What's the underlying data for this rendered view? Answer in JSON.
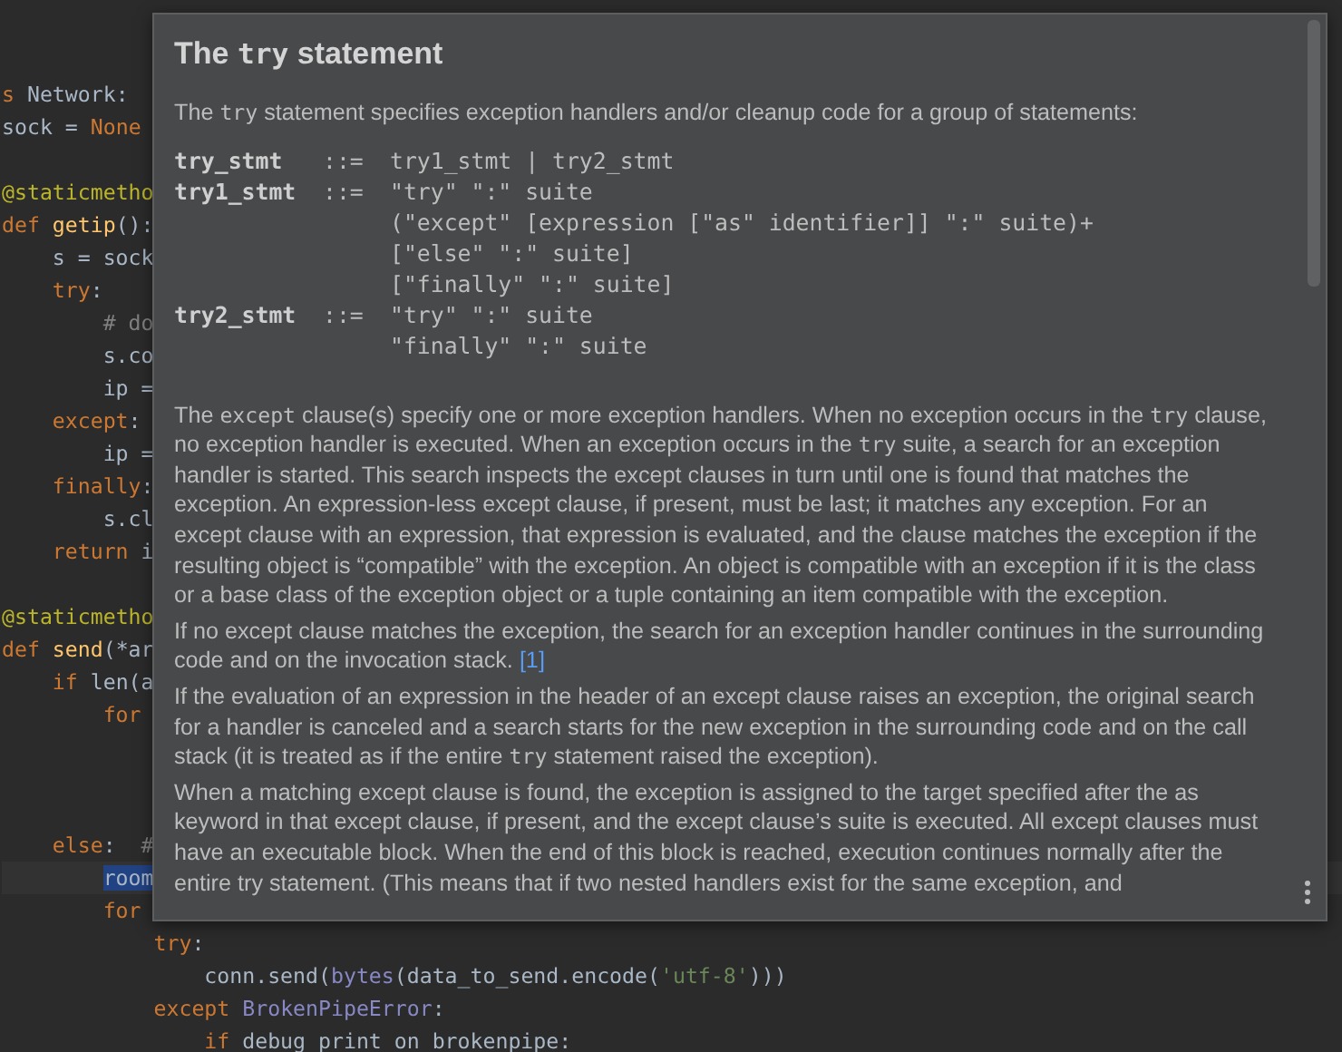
{
  "editor": {
    "lines": [
      {
        "kind": "blank"
      },
      {
        "kind": "blank"
      },
      {
        "kind": "code",
        "tokens": [
          {
            "kind": "keyword",
            "text": "s"
          },
          {
            "kind": "plain",
            "text": " Network:"
          }
        ]
      },
      {
        "kind": "code",
        "tokens": [
          {
            "kind": "plain",
            "text": "sock = "
          },
          {
            "kind": "keyword",
            "text": "None"
          }
        ]
      },
      {
        "kind": "blank"
      },
      {
        "kind": "code",
        "tokens": [
          {
            "kind": "decorator",
            "text": "@staticmetho"
          }
        ]
      },
      {
        "kind": "code",
        "tokens": [
          {
            "kind": "keyword",
            "text": "def "
          },
          {
            "kind": "function",
            "text": "getip"
          },
          {
            "kind": "plain",
            "text": "():"
          }
        ],
        "children": [
          {
            "kind": "code",
            "tokens": [
              {
                "kind": "plain",
                "text": "s = sock"
              }
            ]
          },
          {
            "kind": "code",
            "tokens": [
              {
                "kind": "keyword",
                "text": "try"
              },
              {
                "kind": "plain",
                "text": ":"
              }
            ],
            "children": [
              {
                "kind": "code",
                "tokens": [
                  {
                    "kind": "comment",
                    "text": "# do"
                  }
                ]
              },
              {
                "kind": "code",
                "tokens": [
                  {
                    "kind": "plain",
                    "text": "s.co"
                  }
                ]
              },
              {
                "kind": "code",
                "tokens": [
                  {
                    "kind": "plain",
                    "text": "ip ="
                  }
                ]
              }
            ]
          },
          {
            "kind": "code",
            "tokens": [
              {
                "kind": "keyword",
                "text": "except"
              },
              {
                "kind": "plain",
                "text": ":"
              }
            ],
            "children": [
              {
                "kind": "code",
                "tokens": [
                  {
                    "kind": "plain",
                    "text": "ip ="
                  }
                ]
              }
            ]
          },
          {
            "kind": "code",
            "tokens": [
              {
                "kind": "keyword",
                "text": "finally"
              },
              {
                "kind": "plain",
                "text": ":"
              }
            ],
            "children": [
              {
                "kind": "code",
                "tokens": [
                  {
                    "kind": "plain",
                    "text": "s.cl"
                  }
                ]
              }
            ]
          },
          {
            "kind": "code",
            "tokens": [
              {
                "kind": "keyword",
                "text": "return"
              },
              {
                "kind": "plain",
                "text": " i"
              }
            ]
          }
        ]
      },
      {
        "kind": "blank"
      },
      {
        "kind": "code",
        "tokens": [
          {
            "kind": "decorator",
            "text": "@staticmetho"
          }
        ]
      },
      {
        "kind": "code",
        "tokens": [
          {
            "kind": "keyword",
            "text": "def "
          },
          {
            "kind": "function",
            "text": "send"
          },
          {
            "kind": "plain",
            "text": "(*ar"
          }
        ],
        "children": [
          {
            "kind": "code",
            "tokens": [
              {
                "kind": "keyword",
                "text": "if"
              },
              {
                "kind": "plain",
                "text": " len(a"
              }
            ],
            "children": [
              {
                "kind": "code",
                "tokens": [
                  {
                    "kind": "keyword",
                    "text": "for"
                  }
                ]
              },
              {
                "kind": "blank"
              },
              {
                "kind": "blank"
              },
              {
                "kind": "blank"
              }
            ]
          },
          {
            "kind": "code",
            "tokens": [
              {
                "kind": "keyword",
                "text": "else"
              },
              {
                "kind": "plain",
                "text": ":  "
              },
              {
                "kind": "comment",
                "text": "#"
              }
            ],
            "children": [
              {
                "kind": "code",
                "tokens": [
                  {
                    "kind": "selection",
                    "text": "room"
                  }
                ]
              },
              {
                "kind": "code",
                "tokens": [
                  {
                    "kind": "keyword",
                    "text": "for"
                  }
                ],
                "children": [
                  {
                    "kind": "code",
                    "tokens": [
                      {
                        "kind": "keyword",
                        "text": "try"
                      },
                      {
                        "kind": "plain",
                        "text": ":"
                      }
                    ],
                    "children": [
                      {
                        "kind": "code",
                        "tokens": [
                          {
                            "kind": "plain",
                            "text": "conn.send("
                          },
                          {
                            "kind": "builtin",
                            "text": "bytes"
                          },
                          {
                            "kind": "plain",
                            "text": "(data_to_send.encode("
                          },
                          {
                            "kind": "string",
                            "text": "'utf-8'"
                          },
                          {
                            "kind": "plain",
                            "text": ")))"
                          }
                        ]
                      }
                    ]
                  },
                  {
                    "kind": "code",
                    "tokens": [
                      {
                        "kind": "keyword",
                        "text": "except "
                      },
                      {
                        "kind": "builtin",
                        "text": "BrokenPipeError"
                      },
                      {
                        "kind": "plain",
                        "text": ":"
                      }
                    ],
                    "children": [
                      {
                        "kind": "code",
                        "tokens": [
                          {
                            "kind": "keyword",
                            "text": "if"
                          },
                          {
                            "kind": "plain",
                            "text": " debug print on brokenpipe:"
                          }
                        ]
                      }
                    ]
                  }
                ]
              }
            ]
          }
        ]
      }
    ]
  },
  "doc_popup": {
    "title": [
      {
        "kind": "text",
        "text": "The "
      },
      {
        "kind": "code",
        "text": "try"
      },
      {
        "kind": "text",
        "text": " statement"
      }
    ],
    "intro": [
      {
        "kind": "text",
        "text": "The "
      },
      {
        "kind": "code",
        "text": "try"
      },
      {
        "kind": "text",
        "text": " statement specifies exception handlers and/or cleanup code for a group of statements:"
      }
    ],
    "grammar": [
      {
        "name": "try_stmt",
        "op": "::=",
        "lines": [
          "try1_stmt | try2_stmt"
        ]
      },
      {
        "name": "try1_stmt",
        "op": "::=",
        "lines": [
          "\"try\" \":\" suite",
          "(\"except\" [expression [\"as\" identifier]] \":\" suite)+",
          "[\"else\" \":\" suite]",
          "[\"finally\" \":\" suite]"
        ]
      },
      {
        "name": "try2_stmt",
        "op": "::=",
        "lines": [
          "\"try\" \":\" suite",
          "\"finally\" \":\" suite"
        ]
      }
    ],
    "paragraphs": [
      [
        {
          "kind": "text",
          "text": "The "
        },
        {
          "kind": "code",
          "text": "except"
        },
        {
          "kind": "text",
          "text": " clause(s) specify one or more exception handlers. When no exception occurs in the "
        },
        {
          "kind": "code",
          "text": "try"
        },
        {
          "kind": "text",
          "text": " clause, no exception handler is executed. When an exception occurs in the "
        },
        {
          "kind": "code",
          "text": "try"
        },
        {
          "kind": "text",
          "text": " suite, a search for an exception handler is started. This search inspects the except clauses in turn until one is found that matches the exception. An expression-less except clause, if present, must be last; it matches any exception. For an except clause with an expression, that expression is evaluated, and the clause matches the exception if the resulting object is “compatible” with the exception. An object is compatible with an exception if it is the class or a base class of the exception object or a tuple containing an item compatible with the exception."
        }
      ],
      [
        {
          "kind": "text",
          "text": "If no except clause matches the exception, the search for an exception handler continues in the surrounding code and on the invocation stack. "
        },
        {
          "kind": "link",
          "text": "[1]"
        }
      ],
      [
        {
          "kind": "text",
          "text": "If the evaluation of an expression in the header of an except clause raises an exception, the original search for a handler is canceled and a search starts for the new exception in the surrounding code and on the call stack (it is treated as if the entire "
        },
        {
          "kind": "code",
          "text": "try"
        },
        {
          "kind": "text",
          "text": " statement raised the exception)."
        }
      ],
      [
        {
          "kind": "text",
          "text": "When a matching except clause is found, the exception is assigned to the target specified after the as keyword in that except clause, if present, and the except clause’s suite is executed. All except clauses must have an executable block. When the end of this block is reached, execution continues normally after the entire try statement. (This means that if two nested handlers exist for the same exception, and"
        }
      ]
    ]
  }
}
